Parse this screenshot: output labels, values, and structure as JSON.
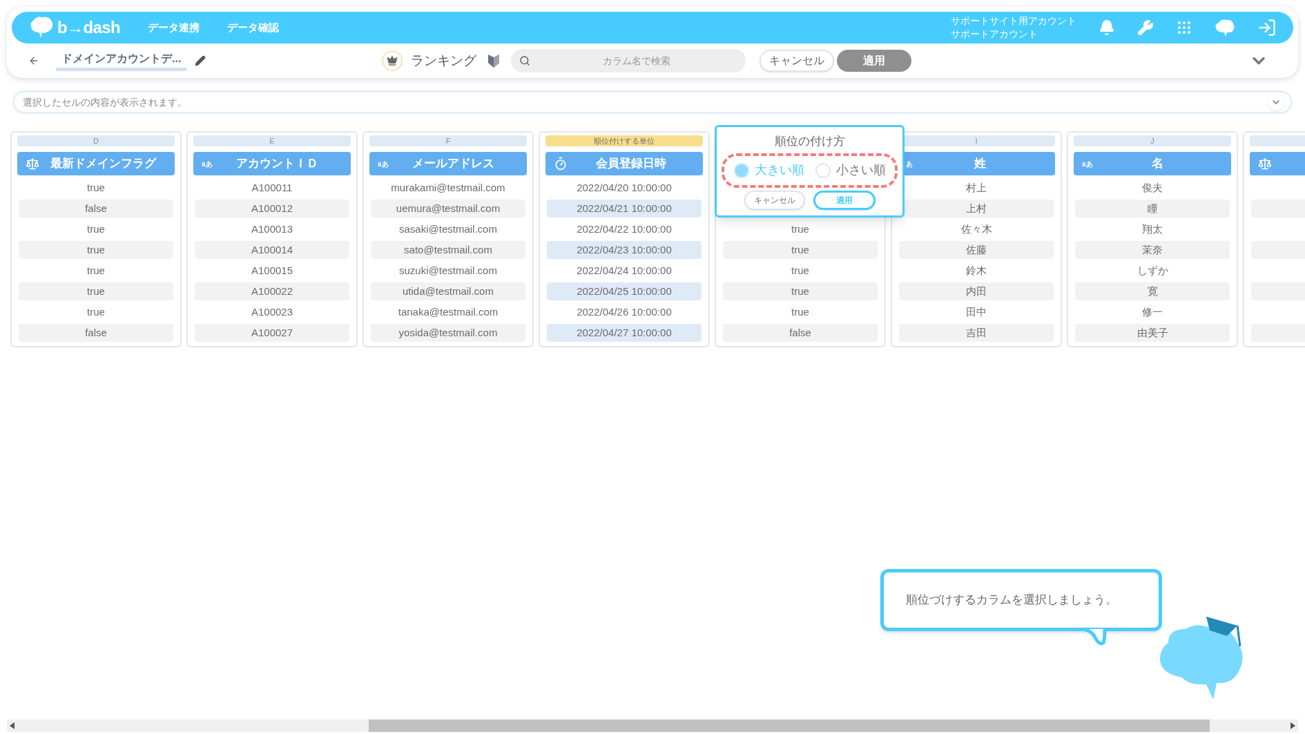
{
  "header": {
    "logo": "b→dash",
    "nav": [
      "データ連携",
      "データ確認"
    ],
    "account": [
      "サポートサイト用アカウント",
      "サポートアカウント"
    ]
  },
  "toolbar": {
    "title": "ドメインアカウントデ...",
    "mode": "ランキング",
    "search": {
      "placeholder": "カラム名で検索"
    },
    "cancel": "キャンセル",
    "apply": "適用"
  },
  "cell_preview": {
    "placeholder": "選択したセルの内容が表示されます。"
  },
  "columns": [
    {
      "letter": "D",
      "title": "最新ドメインフラグ",
      "kind": "bool",
      "selected": false,
      "cells": [
        "true",
        "false",
        "true",
        "true",
        "true",
        "true",
        "true",
        "false"
      ]
    },
    {
      "letter": "E",
      "title": "アカウントＩＤ",
      "kind": "text",
      "type_mark": "aあ",
      "selected": false,
      "cells": [
        "A100011",
        "A100012",
        "A100013",
        "A100014",
        "A100015",
        "A100022",
        "A100023",
        "A100027"
      ]
    },
    {
      "letter": "F",
      "title": "メールアドレス",
      "kind": "text",
      "type_mark": "aあ",
      "selected": false,
      "cells": [
        "murakami@testmail.com",
        "uemura@testmail.com",
        "sasaki@testmail.com",
        "sato@testmail.com",
        "suzuki@testmail.com",
        "utida@testmail.com",
        "tanaka@testmail.com",
        "yosida@testmail.com"
      ]
    },
    {
      "label": "順位付けする単位",
      "title": "会員登録日時",
      "kind": "datetime",
      "selected": true,
      "cells": [
        "2022/04/20 10:00:00",
        "2022/04/21 10:00:00",
        "2022/04/22 10:00:00",
        "2022/04/23 10:00:00",
        "2022/04/24 10:00:00",
        "2022/04/25 10:00:00",
        "2022/04/26 10:00:00",
        "2022/04/27 10:00:00"
      ]
    },
    {
      "selected": false,
      "cells": [
        null,
        null,
        "true",
        "true",
        "true",
        "true",
        "true",
        "false"
      ]
    },
    {
      "letter": "I",
      "title": "姓",
      "kind": "text",
      "type_mark": "あ",
      "selected": false,
      "cells": [
        "村上",
        "上村",
        "佐々木",
        "佐藤",
        "鈴木",
        "内田",
        "田中",
        "吉田"
      ]
    },
    {
      "letter": "J",
      "title": "名",
      "kind": "text",
      "type_mark": "aあ",
      "selected": false,
      "cells": [
        "俊夫",
        "瞳",
        "翔太",
        "茉奈",
        "しずか",
        "寛",
        "修一",
        "由美子"
      ]
    },
    {
      "kind": "bool",
      "selected": false,
      "cells": [
        null,
        null,
        null,
        null,
        null,
        null,
        null,
        null
      ]
    }
  ],
  "sort_popup": {
    "title": "順位の付け方",
    "options": [
      {
        "label": "大きい順",
        "selected": true
      },
      {
        "label": "小さい順",
        "selected": false
      }
    ],
    "cancel": "キャンセル",
    "apply": "適用"
  },
  "guide": {
    "message": "順位づけするカラムを選択しましょう。"
  }
}
